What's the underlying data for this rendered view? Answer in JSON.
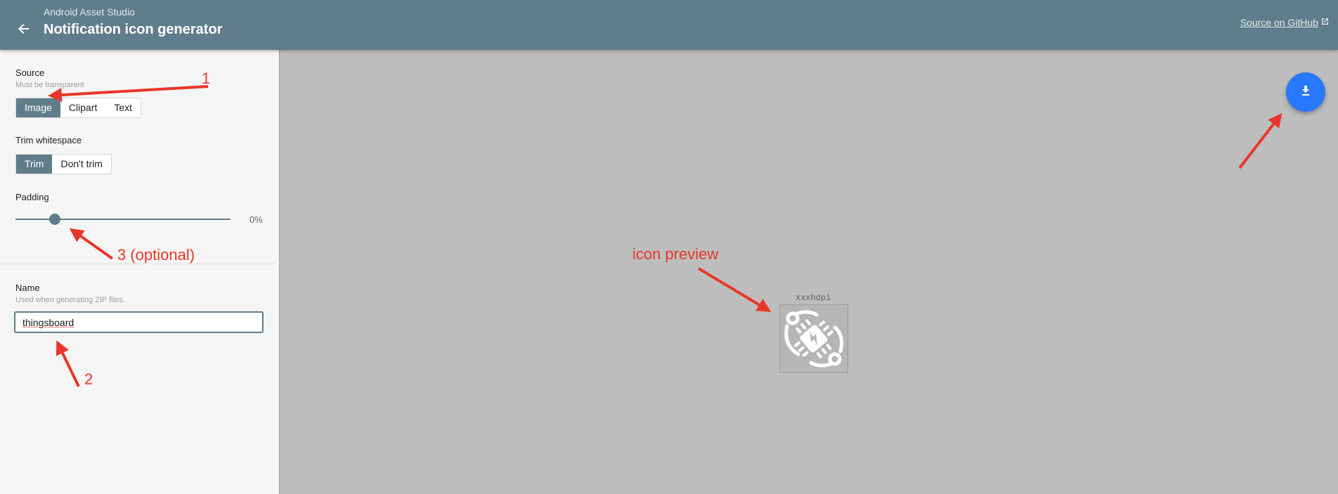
{
  "header": {
    "app_name": "Android Asset Studio",
    "title": "Notification icon generator",
    "github_link": "Source on GitHub"
  },
  "sidebar": {
    "source": {
      "label": "Source",
      "hint": "Must be transparent",
      "options": [
        "Image",
        "Clipart",
        "Text"
      ],
      "selected": "Image"
    },
    "trim": {
      "label": "Trim whitespace",
      "options": [
        "Trim",
        "Don't trim"
      ],
      "selected": "Trim"
    },
    "padding": {
      "label": "Padding",
      "value_text": "0%",
      "value": 0
    },
    "name": {
      "label": "Name",
      "hint": "Used when generating ZIP files.",
      "value": "thingsboard"
    }
  },
  "preview": {
    "density_label": "xxxhdpi"
  },
  "annotations": {
    "a1": "1",
    "a2": "2",
    "a3": "3 (optional)",
    "preview": "icon preview"
  },
  "colors": {
    "header": "#607d8b",
    "accent": "#607d8b",
    "fab": "#2979ff",
    "annotation": "#e8372a"
  }
}
